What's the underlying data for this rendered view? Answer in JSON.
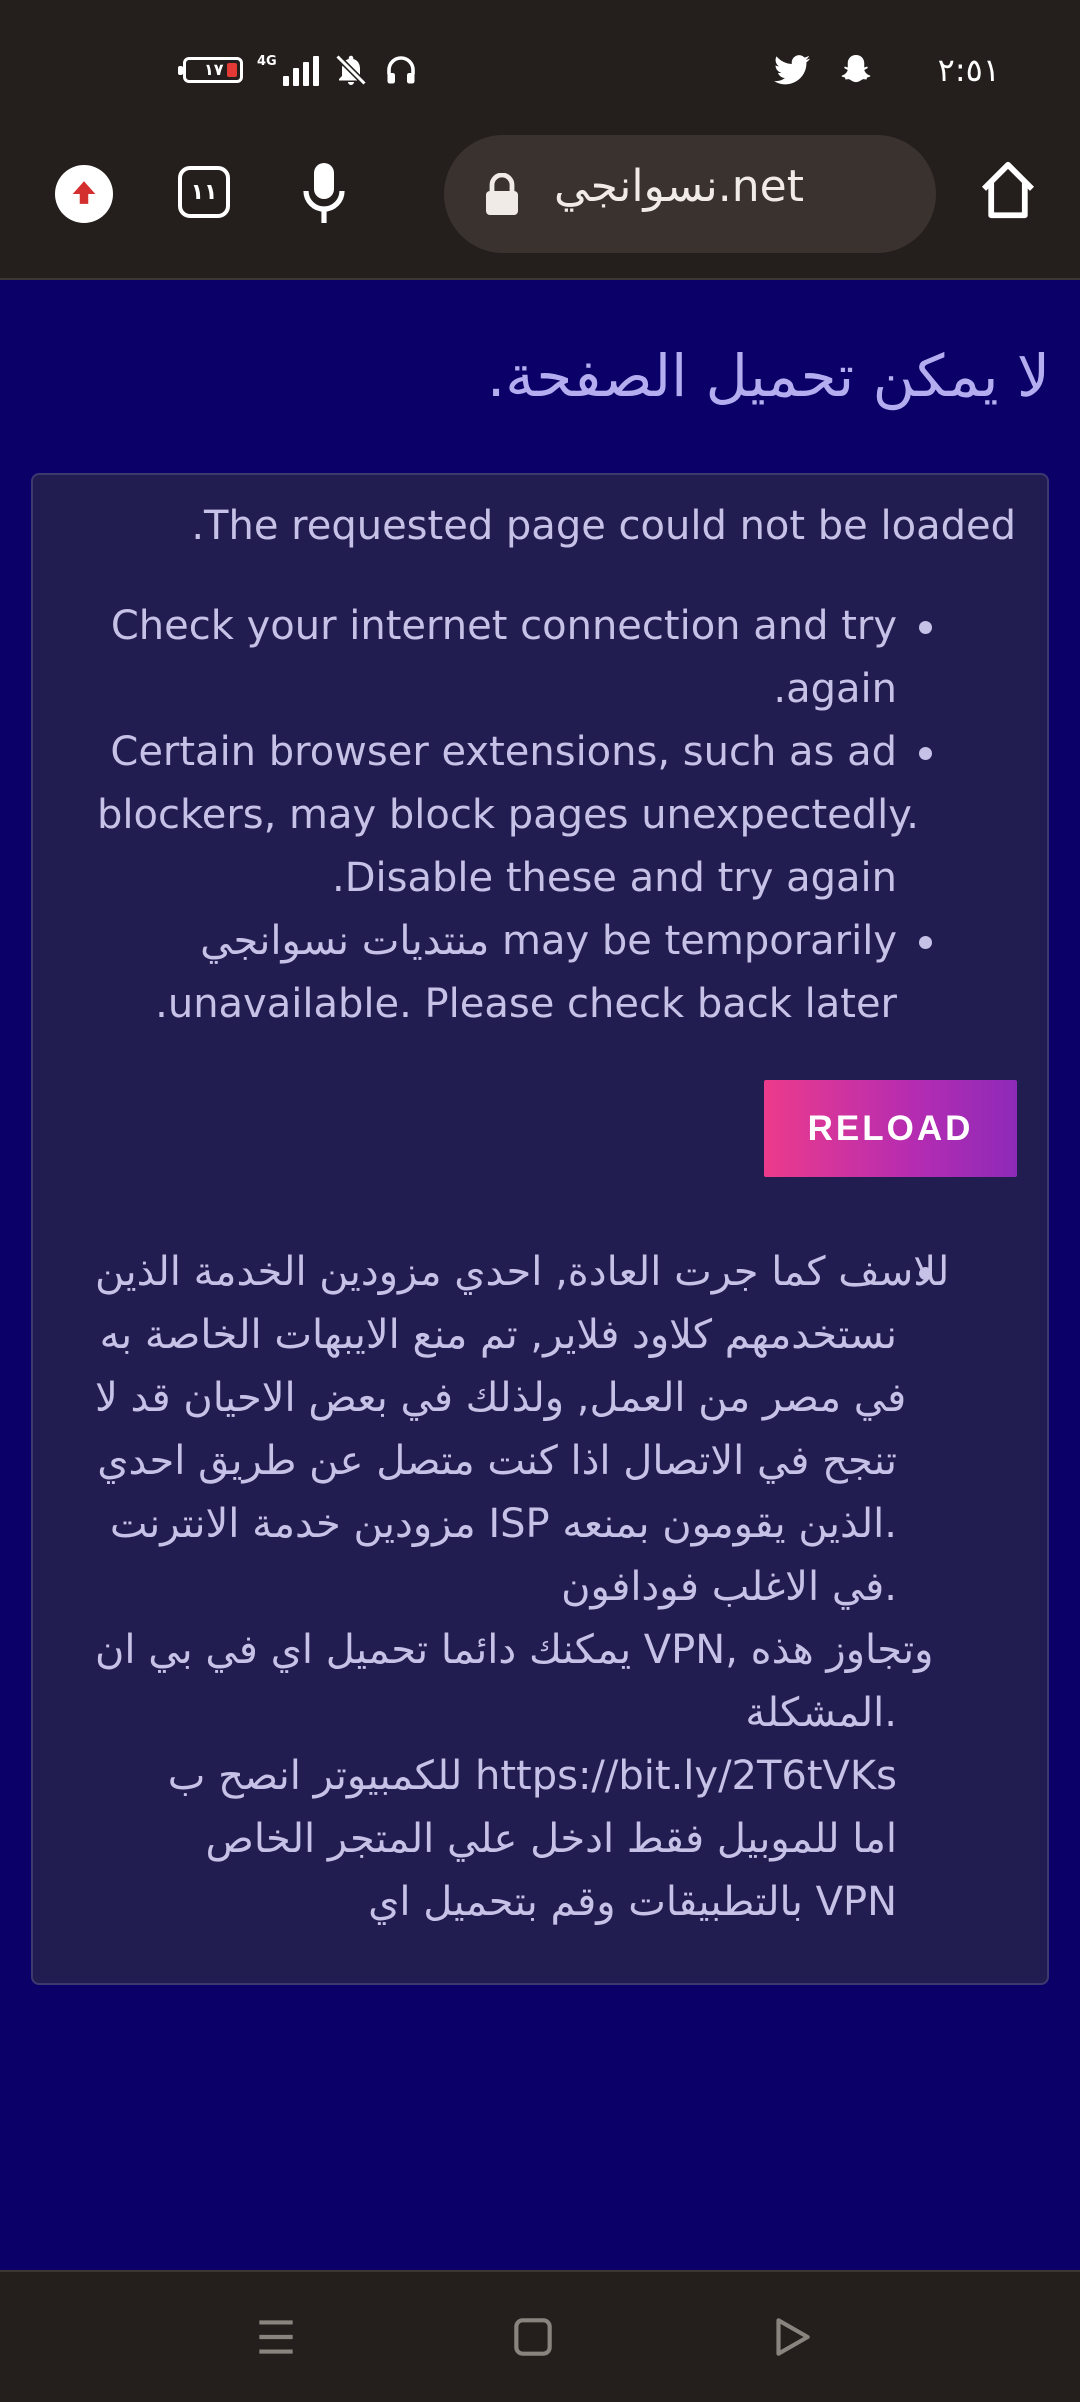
{
  "status_bar": {
    "battery_level": "١٧",
    "network_type": "4G",
    "time": "٢:٥١",
    "icons": [
      "battery-icon",
      "signal-icon",
      "mute-icon",
      "headphones-icon",
      "twitter-icon",
      "snapchat-icon"
    ]
  },
  "toolbar": {
    "tab_count": "١١",
    "url": "نسوانجي.net",
    "icons": [
      "update-icon",
      "tabs-icon",
      "mic-icon",
      "lock-icon",
      "home-icon"
    ]
  },
  "page": {
    "title": "لا يمكن تحميل الصفحة.",
    "lead": ".The requested page could not be loaded",
    "bullets": [
      [
        "Check your internet connection and try",
        ".again"
      ],
      [
        "Certain browser extensions, such as ad",
        "blockers, may block pages unexpectedly.",
        ".Disable these and try again"
      ],
      [
        "منتديات نسوانجي may be temporarily",
        ".unavailable. Please check back later"
      ]
    ],
    "reload_label": "RELOAD",
    "notice": [
      "للاسف كما جرت العادة, احدي مزودين الخدمة الذين",
      "نستخدمهم كلاود فلاير, تم منع الايبهات الخاصة به",
      "في مصر من العمل, ولذلك في بعض الاحيان قد لا",
      "تنجح في الاتصال اذا كنت متصل عن طريق احدي",
      "مزودين خدمة الانترنت ISP الذين يقومون بمنعه.",
      "في الاغلب فودافون.",
      "يمكنك دائما تحميل اي في بي ان VPN, وتجاوز هذه",
      "المشكلة.",
      "للكمبيوتر انصح ب https://bit.ly/2T6tVKs",
      "اما للموبيل فقط ادخل علي المتجر الخاص",
      "بالتطبيقات وقم بتحميل اي VPN"
    ]
  },
  "nav_bar": {
    "icons": [
      "menu-icon",
      "home-square-icon",
      "back-icon"
    ]
  },
  "colors": {
    "page_background": "#0a0068",
    "card_background": "#221d50",
    "chrome_background": "#241f1c",
    "text": "#c6c1e6",
    "title_text": "#b4aef0",
    "reload_gradient_start": "#ec3b8b",
    "reload_gradient_end": "#8e2ab8"
  }
}
